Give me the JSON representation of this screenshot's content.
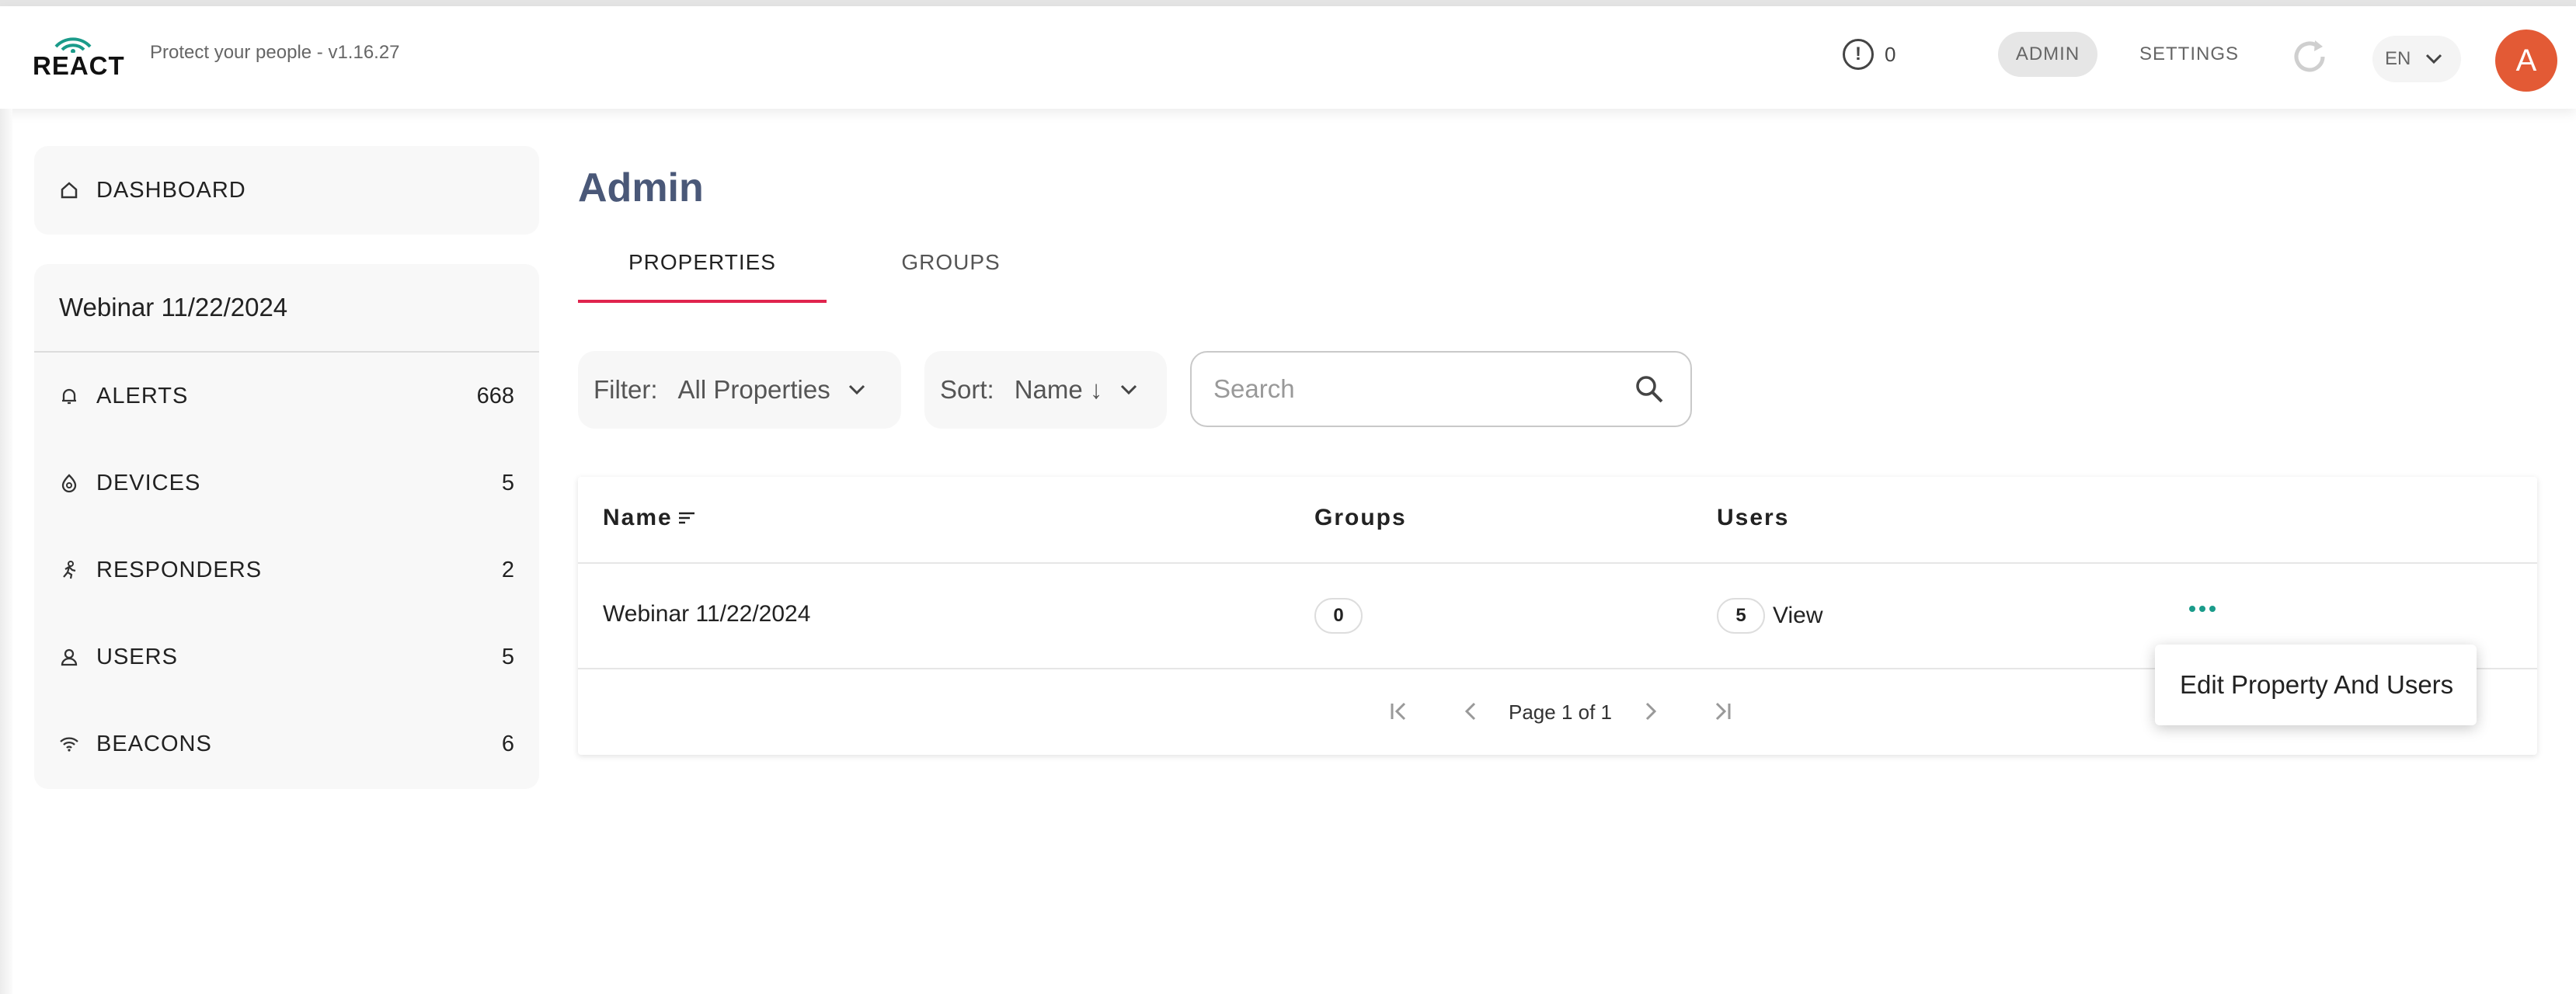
{
  "header": {
    "logo_text": "REACT",
    "tagline": "Protect your people - v1.16.27",
    "alert_count": "0",
    "nav_admin": "ADMIN",
    "nav_settings": "SETTINGS",
    "language": "EN",
    "avatar_initial": "A"
  },
  "sidebar": {
    "dashboard_label": "DASHBOARD",
    "property_name": "Webinar 11/22/2024",
    "items": [
      {
        "label": "ALERTS",
        "count": "668",
        "icon": "bell-icon"
      },
      {
        "label": "DEVICES",
        "count": "5",
        "icon": "device-icon"
      },
      {
        "label": "RESPONDERS",
        "count": "2",
        "icon": "runner-icon"
      },
      {
        "label": "USERS",
        "count": "5",
        "icon": "user-icon"
      },
      {
        "label": "BEACONS",
        "count": "6",
        "icon": "wifi-icon"
      }
    ]
  },
  "main": {
    "title": "Admin",
    "tabs": [
      {
        "label": "PROPERTIES",
        "active": true
      },
      {
        "label": "GROUPS",
        "active": false
      }
    ],
    "filter": {
      "label": "Filter:",
      "value": "All Properties"
    },
    "sort": {
      "label": "Sort:",
      "value": "Name ↓"
    },
    "search": {
      "placeholder": "Search",
      "value": ""
    },
    "table": {
      "columns": [
        "Name",
        "Groups",
        "Users"
      ],
      "rows": [
        {
          "name": "Webinar 11/22/2024",
          "groups": "0",
          "users": "5",
          "view_label": "View"
        }
      ],
      "pagination": "Page 1 of 1"
    },
    "row_menu": {
      "item": "Edit Property And Users"
    }
  },
  "colors": {
    "accent_tab": "#e0244d",
    "avatar": "#e35a35",
    "title": "#4a5878",
    "more_dots": "#1a9b8a"
  }
}
